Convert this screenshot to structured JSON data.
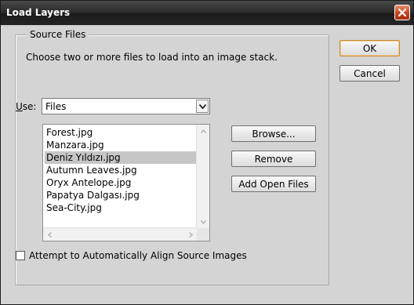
{
  "window": {
    "title": "Load Layers"
  },
  "source_files": {
    "legend": "Source Files",
    "instructions": "Choose two or more files to load into an image stack.",
    "use_label_prefix": "U",
    "use_label_rest": "se:",
    "use_value": "Files",
    "files": [
      {
        "name": "Forest.jpg",
        "selected": false
      },
      {
        "name": "Manzara.jpg",
        "selected": false
      },
      {
        "name": "Deniz Yıldızı.jpg",
        "selected": true
      },
      {
        "name": "Autumn Leaves.jpg",
        "selected": false
      },
      {
        "name": "Oryx Antelope.jpg",
        "selected": false
      },
      {
        "name": "Papatya Dalgası.jpg",
        "selected": false
      },
      {
        "name": "Sea-City.jpg",
        "selected": false
      }
    ],
    "browse_label": "Browse...",
    "remove_label": "Remove",
    "add_open_files_label": "Add Open Files",
    "align_checkbox_label": "Attempt to Automatically Align Source Images",
    "align_checked": false
  },
  "dialog_buttons": {
    "ok_label": "OK",
    "cancel_label": "Cancel"
  },
  "colors": {
    "titlebar": "#262626",
    "dialog_bg": "#d4d4d4",
    "selection": "#c6c6c6",
    "close_button": "#c4401e",
    "default_button_border": "#c58a3a"
  },
  "icons": {
    "close": "close-icon",
    "dropdown": "chevron-down-icon",
    "scroll_up": "arrow-up-icon",
    "scroll_down": "arrow-down-icon",
    "scroll_left": "arrow-left-icon",
    "scroll_right": "arrow-right-icon"
  }
}
